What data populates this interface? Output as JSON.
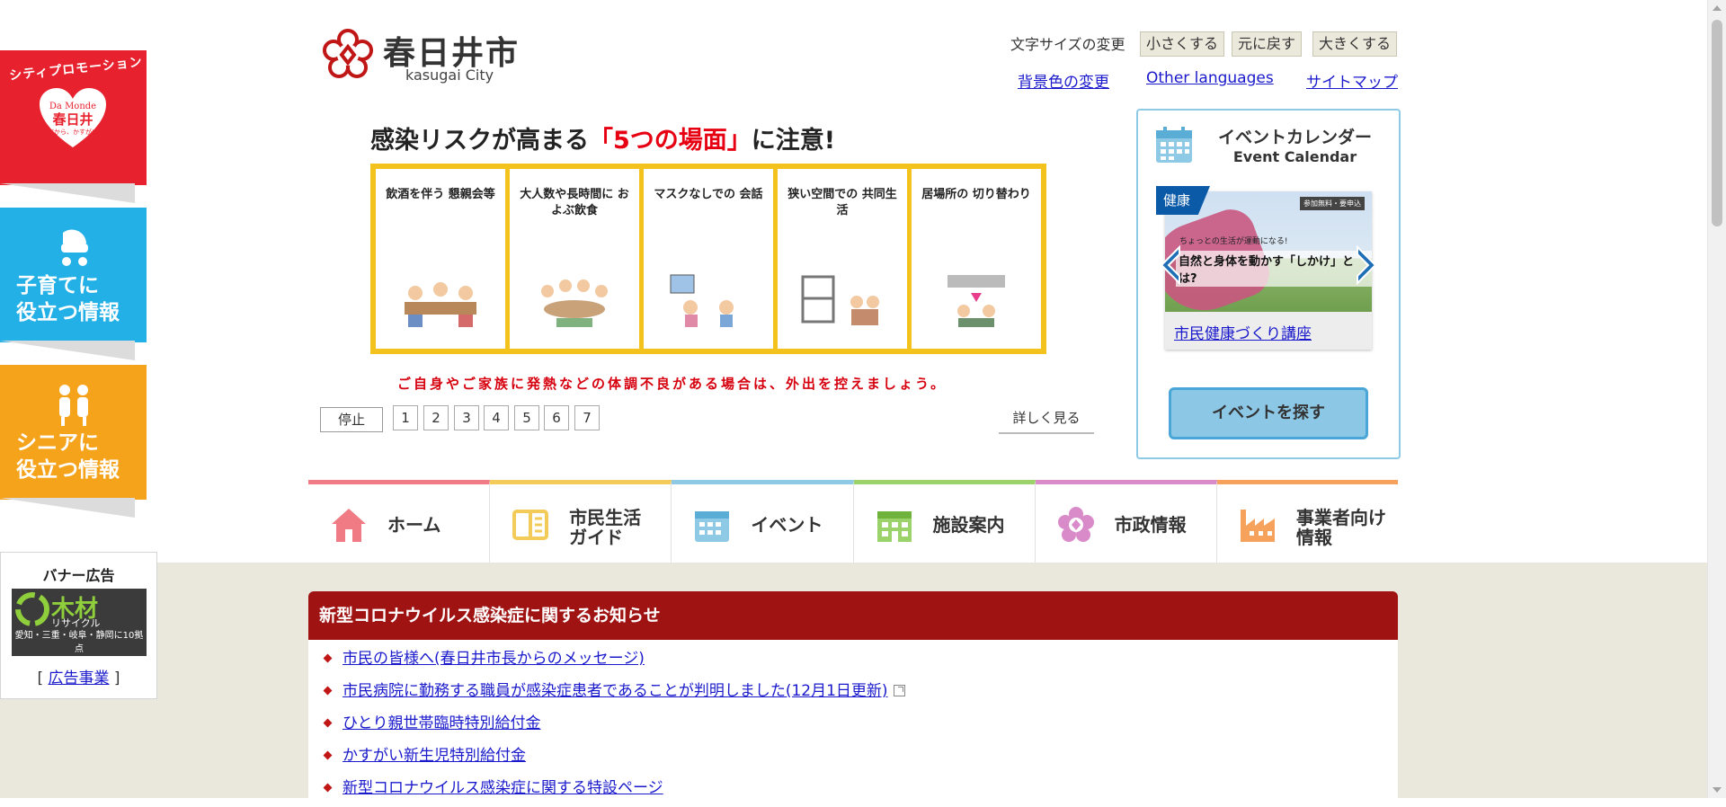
{
  "colors": {
    "brand_red": "#c01616",
    "corona_header": "#a01313",
    "link": "#1a1acc",
    "highlight_red": "#e60012",
    "panel_yellow": "#f3c21c",
    "calendar_border": "#8ecae6",
    "beige_bg": "#eae8dd"
  },
  "header": {
    "logo": {
      "name": "春日井市",
      "sub": "kasugai City"
    },
    "font_size": {
      "label": "文字サイズの変更",
      "buttons": [
        "小さくする",
        "元に戻す",
        "大きくする"
      ]
    },
    "links": {
      "bg_color": "背景色の変更",
      "languages": "Other languages",
      "sitemap": "サイトマップ"
    }
  },
  "left_banners": {
    "city_promotion": {
      "arc_text": "シティプロモーション",
      "heart_line1": "Da Monde",
      "heart_line2": "春日井",
      "heart_line3": "だから、かすがい"
    },
    "kids": {
      "line1": "子育てに",
      "line2": "役立つ情報"
    },
    "senior": {
      "line1": "シニアに",
      "line2": "役立つ情報"
    },
    "ad": {
      "title": "バナー広告",
      "banner_main": "木材",
      "banner_sub": "リサイクル",
      "banner_foot": "愛知・三重・岐阜・静岡に10拠点",
      "link_open": "[",
      "link_text": "広告事業",
      "link_close": "]"
    }
  },
  "slideshow": {
    "headline_pre": "感染リスクが高まる",
    "headline_hl": "「5つの場面」",
    "headline_post": "に注意!",
    "panels": [
      "飲酒を伴う 懇親会等",
      "大人数や長時間に およぶ飲食",
      "マスクなしでの 会話",
      "狭い空間での 共同生活",
      "居場所の 切り替わり"
    ],
    "caption": "ご自身やご家族に発熱などの体調不良がある場合は、外出を控えましょう。",
    "controls": {
      "stop": "停止",
      "pages": [
        "1",
        "2",
        "3",
        "4",
        "5",
        "6",
        "7"
      ],
      "more": "詳しく見る"
    }
  },
  "event_calendar": {
    "title": "イベントカレンダー",
    "subtitle": "Event Calendar",
    "card": {
      "category": "健康",
      "image_tagline": "ちょっとの生活が運動になる!",
      "image_headline": "自然と身体を動かす「しかけ」とは?",
      "image_chip": "参加無料・要申込",
      "link": "市民健康づくり講座"
    },
    "find_button": "イベントを探す"
  },
  "global_nav": [
    {
      "label": "ホーム",
      "color": "#f07b84",
      "icon": "home-icon"
    },
    {
      "label": "市民生活ガイド",
      "line1": "市民生活",
      "line2": "ガイド",
      "color": "#f3cb5a",
      "icon": "guide-book-icon"
    },
    {
      "label": "イベント",
      "color": "#8ecae6",
      "icon": "calendar-icon"
    },
    {
      "label": "施設案内",
      "color": "#9bd36a",
      "icon": "facility-icon"
    },
    {
      "label": "市政情報",
      "color": "#d98ac8",
      "icon": "city-flower-icon"
    },
    {
      "label": "事業者向け情報",
      "line1": "事業者向け",
      "line2": "情報",
      "color": "#f6a25c",
      "icon": "factory-icon"
    }
  ],
  "corona_notice": {
    "title": "新型コロナウイルス感染症に関するお知らせ",
    "items": [
      {
        "text": "市民の皆様へ(春日井市長からのメッセージ)",
        "external": false
      },
      {
        "text": "市民病院に勤務する職員が感染症患者であることが判明しました(12月1日更新)",
        "external": true
      },
      {
        "text": "ひとり親世帯臨時特別給付金",
        "external": false
      },
      {
        "text": "かすがい新生児特別給付金",
        "external": false
      },
      {
        "text": "新型コロナウイルス感染症に関する特設ページ",
        "external": false
      }
    ]
  }
}
